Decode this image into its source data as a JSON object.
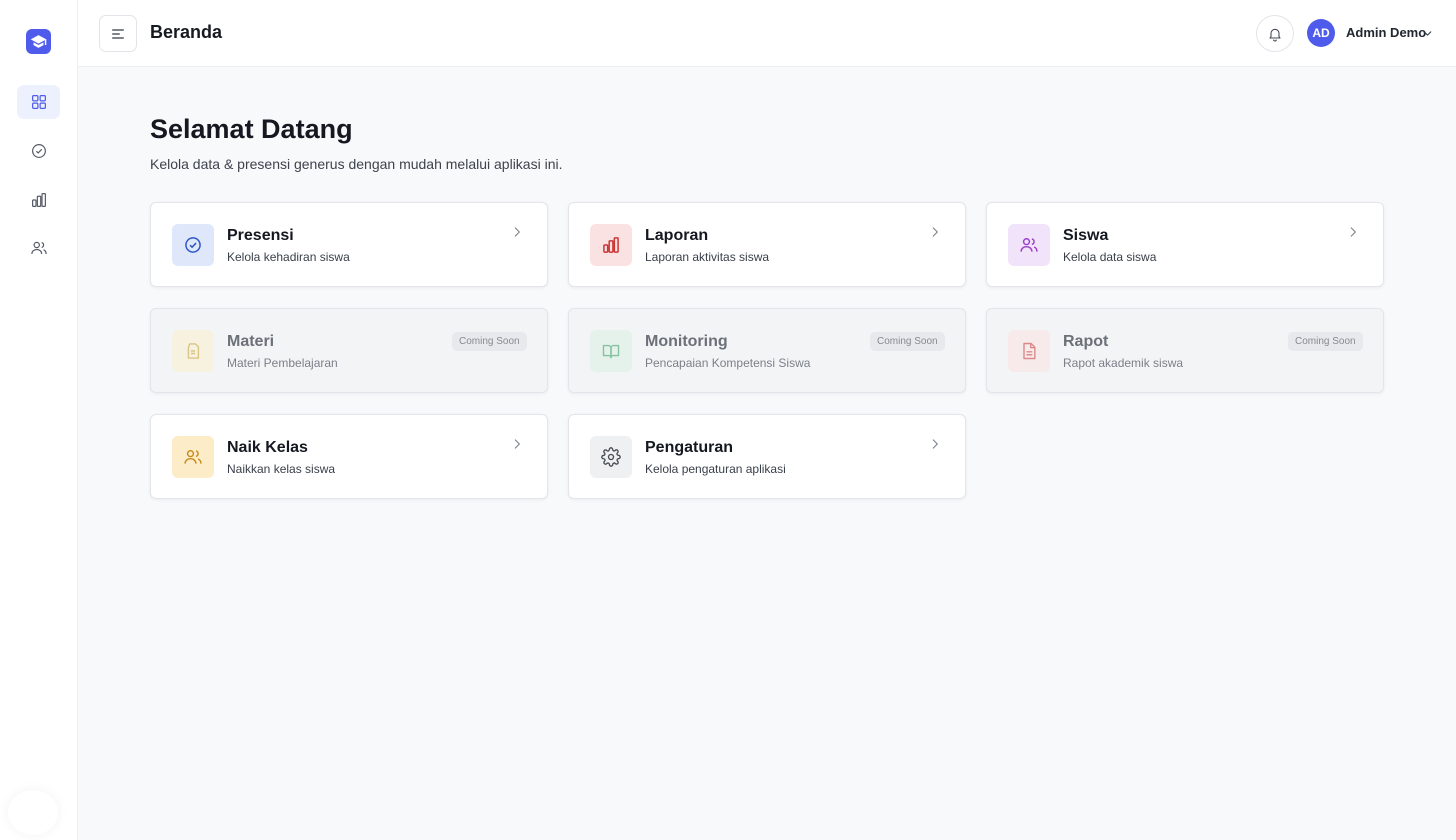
{
  "header": {
    "title": "Beranda",
    "user": {
      "initials": "AD",
      "name": "Admin Demo"
    }
  },
  "sidebar": {
    "items": [
      {
        "id": "dashboard",
        "icon": "grid-icon",
        "active": true
      },
      {
        "id": "presensi",
        "icon": "check-circle-icon",
        "active": false
      },
      {
        "id": "laporan",
        "icon": "bar-chart-icon",
        "active": false
      },
      {
        "id": "siswa",
        "icon": "users-icon",
        "active": false
      }
    ]
  },
  "welcome": {
    "title": "Selamat Datang",
    "subtitle": "Kelola data & presensi generus dengan mudah melalui aplikasi ini."
  },
  "cards": [
    {
      "title": "Presensi",
      "desc": "Kelola kehadiran siswa",
      "icon": "check-circle-icon",
      "color": "#2f56c9",
      "bg": "#dfe8fb",
      "enabled": true
    },
    {
      "title": "Laporan",
      "desc": "Laporan aktivitas siswa",
      "icon": "bar-chart-icon",
      "color": "#c93535",
      "bg": "#fbe2e2",
      "enabled": true
    },
    {
      "title": "Siswa",
      "desc": "Kelola data siswa",
      "icon": "users-icon",
      "color": "#9b3ec8",
      "bg": "#f1e3f9",
      "enabled": true
    },
    {
      "title": "Materi",
      "desc": "Materi Pembelajaran",
      "icon": "document-icon",
      "color": "#c9a02a",
      "bg": "#fbf1cf",
      "enabled": false,
      "badge": "Coming Soon"
    },
    {
      "title": "Monitoring",
      "desc": "Pencapaian Kompetensi Siswa",
      "icon": "book-open-icon",
      "color": "#2f9a5b",
      "bg": "#dbf2e4",
      "enabled": false,
      "badge": "Coming Soon"
    },
    {
      "title": "Rapot",
      "desc": "Rapot akademik siswa",
      "icon": "file-text-icon",
      "color": "#c93535",
      "bg": "#fbe2e2",
      "enabled": false,
      "badge": "Coming Soon"
    },
    {
      "title": "Naik Kelas",
      "desc": "Naikkan kelas siswa",
      "icon": "users-icon",
      "color": "#c98b1e",
      "bg": "#fcecc7",
      "enabled": true
    },
    {
      "title": "Pengaturan",
      "desc": "Kelola pengaturan aplikasi",
      "icon": "gear-icon",
      "color": "#444a54",
      "bg": "#eff0f2",
      "enabled": true
    }
  ],
  "colors": {
    "accent": "#4f5bea"
  }
}
